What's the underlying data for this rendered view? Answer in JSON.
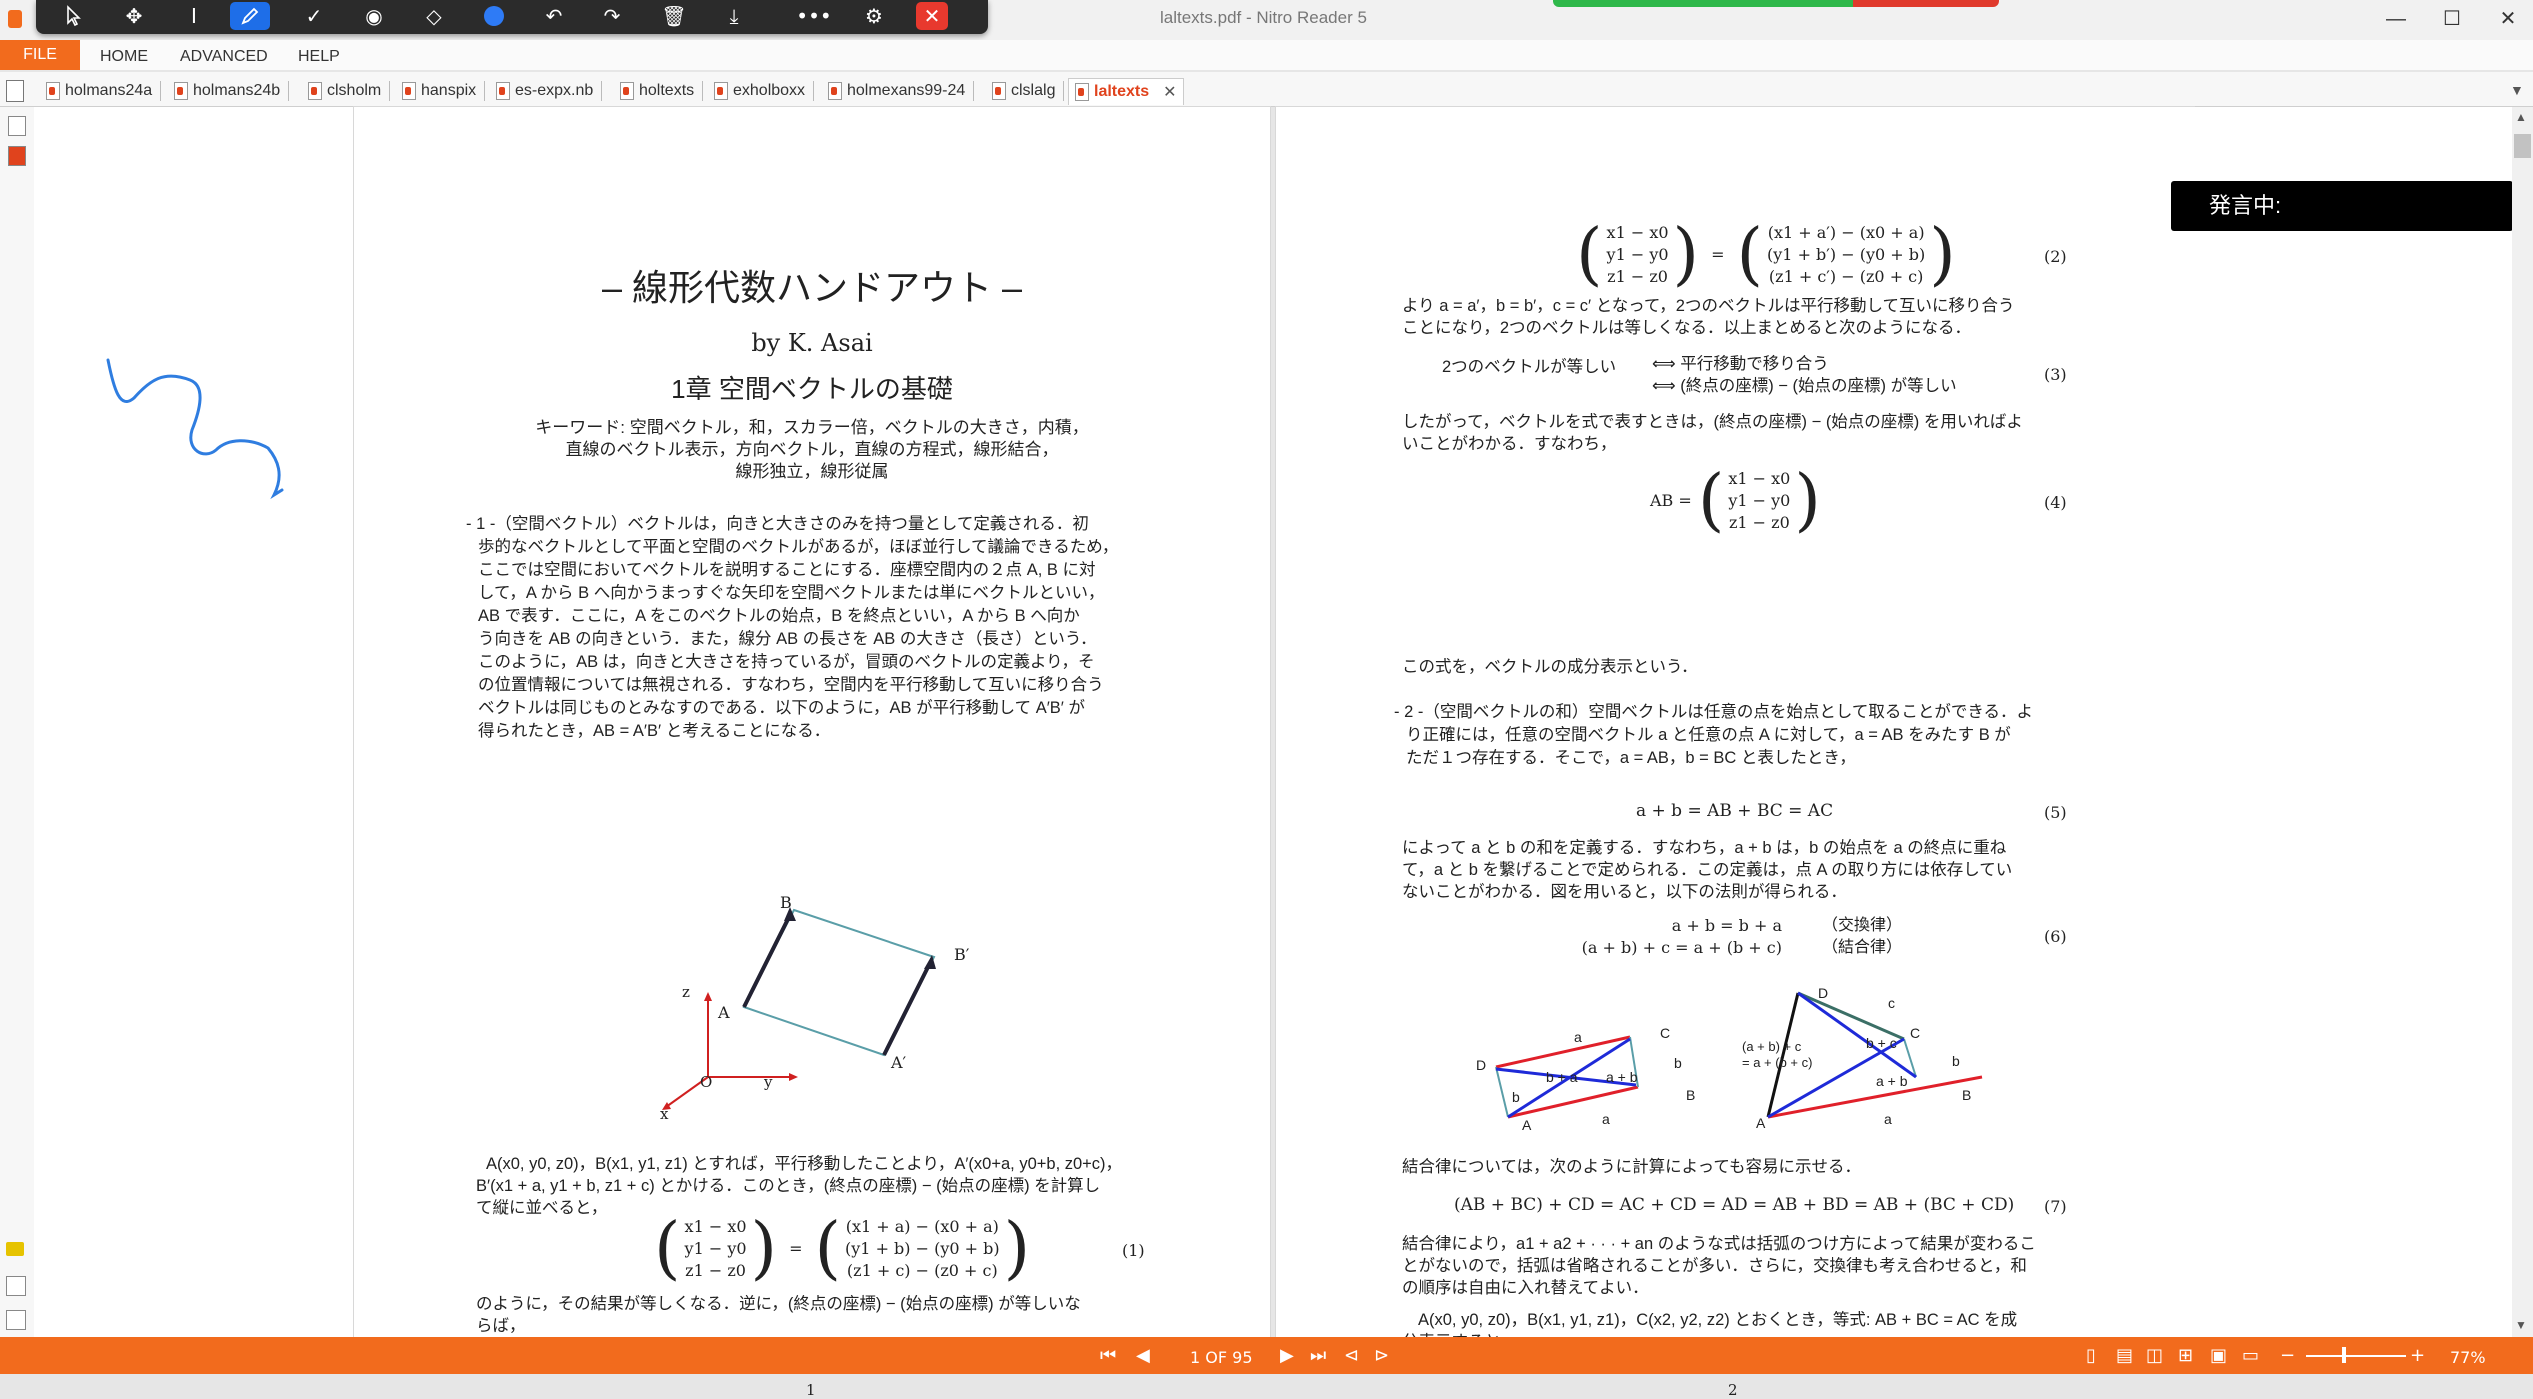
{
  "window": {
    "title": "laltexts.pdf - Nitro Reader 5",
    "minimize": "—",
    "maximize": "☐",
    "close": "✕"
  },
  "annotation_toolbar": {
    "more": "•••",
    "close": "✕"
  },
  "menu": {
    "file": "FILE",
    "items": [
      "HOME",
      "ADVANCED",
      "HELP"
    ]
  },
  "tabs": [
    "holmans24a",
    "holmans24b",
    "clsholm",
    "hanspix",
    "es-expx.nb",
    "holtexts",
    "exholboxx",
    "holmexans99-24",
    "clslalg"
  ],
  "active_tab": "laltexts",
  "page1": {
    "title": "– 線形代数ハンドアウト –",
    "author": "by K. Asai",
    "chapter": "1章  空間ベクトルの基礎",
    "keywords": [
      "キーワード: 空間ベクトル，和，スカラー倍，ベクトルの大きさ，内積，",
      "直線のベクトル表示，方向ベクトル，直線の方程式，線形結合，",
      "線形独立，線形従属"
    ],
    "para1": [
      "- 1 -（空間ベクトル）ベクトルは，向きと大きさのみを持つ量として定義される．初",
      "歩的なベクトルとして平面と空間のベクトルがあるが，ほぼ並行して議論できるため，",
      "ここでは空間においてベクトルを説明することにする．座標空間内の２点 A, B に対",
      "して，A から B へ向かうまっすぐな矢印を空間ベクトルまたは単にベクトルといい，",
      "AB で表す．ここに，A をこのベクトルの始点，B を終点といい，A から B へ向か",
      "う向きを AB の向きという．また，線分 AB の長さを AB の大きさ（長さ）という．",
      "このように，AB は，向きと大きさを持っているが，冒頭のベクトルの定義より，そ",
      "の位置情報については無視される．すなわち，空間内を平行移動して互いに移り合う",
      "ベクトルは同じものとみなすのである．以下のように，AB が平行移動して A′B′ が",
      "得られたとき，AB = A′B′ と考えることになる．"
    ],
    "fig_labels": {
      "B": "B",
      "Bp": "B′",
      "A": "A",
      "Ap": "A′",
      "z": "z",
      "O": "O",
      "y": "y",
      "x": "x"
    },
    "para2": [
      "A(x0, y0, z0)，B(x1, y1, z1) とすれば，平行移動したことより，A′(x0+a, y0+b, z0+c)，",
      "B′(x1 + a, y1 + b, z1 + c) とかける．このとき，(終点の座標) − (始点の座標) を計算し",
      "て縦に並べると，"
    ],
    "eq1_left": [
      "x1 − x0",
      "y1 − y0",
      "z1 − z0"
    ],
    "eq1_right": [
      "(x1 + a) − (x0 + a)",
      "(y1 + b) − (y0 + b)",
      "(z1 + c) − (z0 + c)"
    ],
    "eq1_no": "(1)",
    "para3": [
      "のように，その結果が等しくなる．逆に，(終点の座標) − (始点の座標) が等しいな",
      "らば，"
    ],
    "page_no": "1"
  },
  "page2": {
    "eq2_left": [
      "x1 − x0",
      "y1 − y0",
      "z1 − z0"
    ],
    "eq2_right": [
      "(x1 + a′) − (x0 + a)",
      "(y1 + b′) − (y0 + b)",
      "(z1 + c′) − (z0 + c)"
    ],
    "eq2_no": "(2)",
    "p1": [
      "より a = a′，b = b′，c = c′ となって，2つのベクトルは平行移動して互いに移り合う",
      "ことになり，2つのベクトルは等しくなる．以上まとめると次のようになる．"
    ],
    "eq3_a": "2つのベクトルが等しい",
    "eq3_b": [
      "⟺  平行移動で移り合う",
      "⟺  (終点の座標) − (始点の座標) が等しい"
    ],
    "eq3_no": "(3)",
    "p2": [
      "したがって，ベクトルを式で表すときは，(終点の座標) − (始点の座標) を用いればよ",
      "いことがわかる．すなわち，"
    ],
    "eq4_left": "AB =",
    "eq4_vec": [
      "x1 − x0",
      "y1 − y0",
      "z1 − z0"
    ],
    "eq4_no": "(4)",
    "p3": "この式を，ベクトルの成分表示という．",
    "p4": [
      "- 2 -（空間ベクトルの和）空間ベクトルは任意の点を始点として取ることができる．よ",
      "り正確には，任意の空間ベクトル a と任意の点 A に対して，a = AB をみたす B が",
      "ただ１つ存在する．そこで，a = AB，b = BC と表したとき，"
    ],
    "eq5": "a + b = AB + BC = AC",
    "eq5_no": "(5)",
    "p5": [
      "によって a と b の和を定義する．すなわち，a + b は，b の始点を a の終点に重ね",
      "て，a と b を繋げることで定められる．この定義は，点 A の取り方には依存してい",
      "ないことがわかる．図を用いると，以下の法則が得られる．"
    ],
    "eq6": [
      "a + b = b + a",
      "(a + b) + c = a + (b + c)"
    ],
    "eq6_tags": [
      "（交換律）",
      "（結合律）"
    ],
    "eq6_no": "(6)",
    "figL": {
      "D": "D",
      "C": "C",
      "A": "A",
      "B": "B",
      "a_top": "a",
      "a_bot": "a",
      "b_left": "b",
      "b_right": "b",
      "bpa": "b + a",
      "apb": "a + b"
    },
    "figR": {
      "D": "D",
      "C": "C",
      "A": "A",
      "B": "B",
      "c": "c",
      "bpc": "b + c",
      "b": "b",
      "apb": "a + b",
      "a": "a",
      "assoc1": "(a + b) + c",
      "assoc2": "= a + (b + c)"
    },
    "p6": "結合律については，次のように計算によっても容易に示せる．",
    "eq7": "(AB + BC) + CD = AC + CD = AD = AB + BD = AB + (BC + CD)",
    "eq7_no": "(7)",
    "p7": [
      "結合律により，a1 + a2 + · · · + an のような式は括弧のつけ方によって結果が変わるこ",
      "とがないので，括弧は省略されることが多い．さらに，交換律も考え合わせると，和",
      "の順序は自由に入れ替えてよい．"
    ],
    "p8": [
      "A(x0, y0, z0)，B(x1, y1, z1)，C(x2, y2, z2) とおくとき，等式: AB + BC = AC を成",
      "分表示すると，"
    ],
    "page_no": "2"
  },
  "speech": "発言中:",
  "status": {
    "page": "1 OF 95",
    "zoom": "77%",
    "minus": "−",
    "plus": "+"
  }
}
